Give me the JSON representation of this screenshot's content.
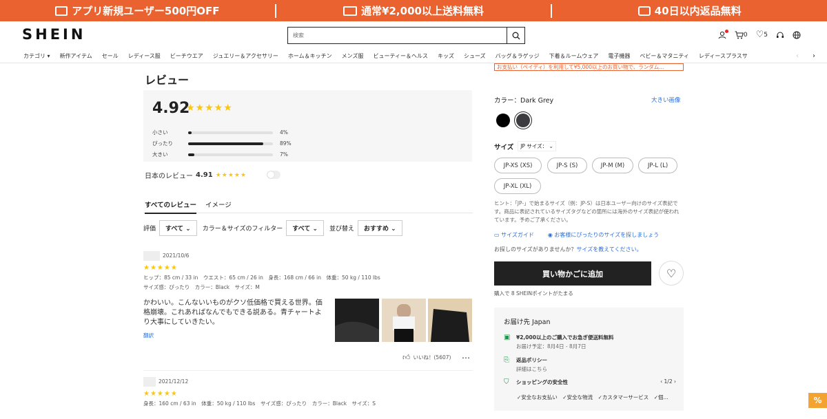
{
  "promo": {
    "item1": "アプリ新規ユーザー500円OFF",
    "item2": "通常¥2,000以上送料無料",
    "item3": "40日以内返品無料"
  },
  "header": {
    "logo": "SHEIN",
    "search_placeholder": "検索",
    "cart_count": "0",
    "wishlist_count": "5"
  },
  "nav": {
    "items": [
      "カテゴリ ▾",
      "新作アイテム",
      "セール",
      "レディース服",
      "ビーチウエア",
      "ジュエリー＆アクセサリー",
      "ホーム＆キッチン",
      "メンズ服",
      "ビューティー＆ヘルス",
      "キッズ",
      "シューズ",
      "バッグ＆ラゲッジ",
      "下着＆ルームウェア",
      "電子機器",
      "ベビー＆マタニティ",
      "レディースプラスサ"
    ]
  },
  "reviews": {
    "heading": "レビュー",
    "score": "4.92",
    "stars": "★★★★★",
    "fit": [
      {
        "label": "小さい",
        "pct_text": "4%",
        "value": 0.04
      },
      {
        "label": "ぴったり",
        "pct_text": "89%",
        "value": 0.89
      },
      {
        "label": "大きい",
        "pct_text": "7%",
        "value": 0.07
      }
    ],
    "jp_label": "日本のレビュー",
    "jp_score": "4.91",
    "tab_all": "すべてのレビュー",
    "tab_image": "イメージ",
    "filter_rating": "評価",
    "filter_rating_val": "すべて",
    "filter_color_size": "カラー＆サイズのフィルター",
    "filter_color_size_val": "すべて",
    "sort_label": "並び替え",
    "sort_val": "おすすめ",
    "items": [
      {
        "date": "2021/10/6",
        "stars": "★★★★★",
        "meta1": "ヒップ：85 cm / 33 in　ウエスト：65 cm / 26 in　身長：168 cm / 66 in　体重：50 kg / 110 lbs",
        "meta2": "サイズ感：ぴったり　カラー：Black　サイズ：M",
        "text": "かわいい。こんないいものがクソ低価格で買える世界。価格崩壊。これあればなんでもできる説ある。青チャートより大事にしていきたい。",
        "translate": "翻訳",
        "likes": "いいね！(5607)"
      },
      {
        "date": "2021/12/12",
        "stars": "★★★★★",
        "meta1": "身長：160 cm / 63 in　体重：50 kg / 110 lbs　サイズ感：ぴったり　カラー：Black　サイズ：S"
      }
    ]
  },
  "product": {
    "top_note": "お支払い（ペイディ）を利用して¥5,000以上のお買い物で、ランダム...",
    "color_label": "カラー",
    "color_value": "：Dark Grey",
    "large_image": "大きい画像",
    "size_label": "サイズ",
    "size_select": "JP サイズ：",
    "sizes": [
      "JP-XS (XS)",
      "JP-S (S)",
      "JP-M (M)",
      "JP-L (L)",
      "JP-XL (XL)"
    ],
    "hint": "ヒント：「JP-」で始まるサイズ（例：JP-S）は日本ユーザー向けのサイズ表記です。商品に表記されているサイズタグなどの箇所には海外のサイズ表記が使われています。予めご了承ください。",
    "size_guide": "サイズガイド",
    "find_size": "お客様にぴったりのサイズを探しましょう",
    "no_size": "お探しのサイズがありませんか？",
    "no_size_link": "サイズを教えてください。",
    "add_to_cart": "買い物かごに追加",
    "points": "購入で 8 SHEINポイントがたまる"
  },
  "shipping": {
    "title": "お届け先 Japan",
    "free_ship": "¥2,000以上のご購入でお急ぎ便送料無料",
    "free_ship_sub": "お届け予定：8月4日 - 8月7日",
    "return_policy": "返品ポリシー",
    "return_sub": "詳細はこちら",
    "safety": "ショッピングの安全性",
    "pager": "1/2",
    "guarantees": "✓安全なお支払い　✓安全な物流　✓カスタマーサービス　✓個..."
  },
  "colors": {
    "accent": "#e9622f",
    "star": "#fac70f",
    "link": "#2a6fd8",
    "green": "#1a9a4a"
  }
}
